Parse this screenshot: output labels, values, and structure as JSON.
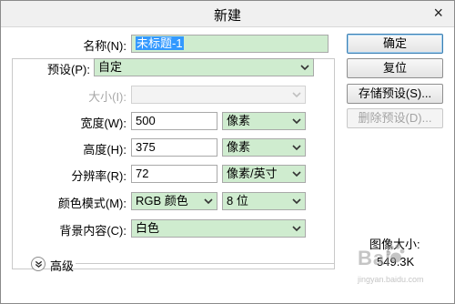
{
  "window": {
    "title": "新建",
    "close_glyph": "×"
  },
  "form": {
    "name_label": "名称(N):",
    "name_value": "未标题-1",
    "preset_label": "预设(P):",
    "preset_value": "自定",
    "size_label": "大小(I):",
    "size_value": "",
    "width_label": "宽度(W):",
    "width_value": "500",
    "width_unit": "像素",
    "height_label": "高度(H):",
    "height_value": "375",
    "height_unit": "像素",
    "resolution_label": "分辨率(R):",
    "resolution_value": "72",
    "resolution_unit": "像素/英寸",
    "color_mode_label": "颜色模式(M):",
    "color_mode_value": "RGB 颜色",
    "bit_depth_value": "8 位",
    "background_label": "背景内容(C):",
    "background_value": "白色",
    "advanced_label": "高级"
  },
  "buttons": {
    "ok": "确定",
    "reset": "复位",
    "save_preset": "存储预设(S)...",
    "delete_preset": "删除预设(D)..."
  },
  "info": {
    "image_size_label": "图像大小:",
    "image_size_value": "549.3K"
  },
  "watermark": {
    "text": "Bai",
    "url": "jingyan.baidu.com"
  },
  "colors": {
    "field_green": "#cfeccf",
    "selection": "#3399ff",
    "default_button_border": "#3c7fb1"
  },
  "icons": {
    "dropdown": "chevron-down-icon",
    "advanced": "double-chevron-down-icon",
    "close": "close-icon"
  }
}
